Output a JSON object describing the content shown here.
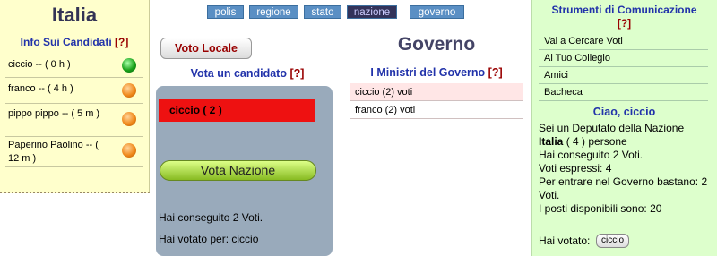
{
  "left": {
    "country": "Italia",
    "info_title": "Info Sui Candidati",
    "help": "[?]",
    "candidates": [
      {
        "name": "ciccio -- ( 0 h )",
        "status": "green"
      },
      {
        "name": "franco -- ( 4 h )",
        "status": "orange"
      },
      {
        "name": "pippo pippo -- ( 5 m )",
        "status": "orange"
      },
      {
        "name": "Paperino Paolino -- ( 12 m )",
        "status": "orange"
      }
    ]
  },
  "nav": {
    "items": [
      {
        "label": "polis"
      },
      {
        "label": "regione"
      },
      {
        "label": "stato"
      },
      {
        "label": "nazione",
        "active": true
      },
      {
        "label": "governo"
      }
    ]
  },
  "vote": {
    "locale_button": "Voto Locale",
    "title": "Vota un candidato",
    "help": "[?]",
    "selected": "ciccio ( 2 )",
    "vote_button": "Vota Nazione",
    "line1": "Hai conseguito 2 Voti.",
    "line2": "Hai votato per: ciccio"
  },
  "governo": {
    "title": "Governo",
    "subtitle": "I Ministri del Governo",
    "help": "[?]",
    "ministers": [
      {
        "label": "ciccio (2) voti"
      },
      {
        "label": "franco (2) voti"
      }
    ]
  },
  "right": {
    "title": "Strumenti di Comunicazione",
    "help": "[?]",
    "items": [
      {
        "label": "Vai a Cercare Voti"
      },
      {
        "label": "Al Tuo Collegio"
      },
      {
        "label": "Amici"
      },
      {
        "label": "Bacheca"
      }
    ],
    "greeting": "Ciao, ciccio",
    "p1": "Sei un Deputato della Nazione",
    "p2_bold": "Italia",
    "p2_rest": " ( 4 ) persone",
    "p3": "Hai conseguito 2 Voti.",
    "p4": "Voti espressi: 4",
    "p5": "Per entrare nel Governo bastano: 2 Voti.",
    "p6": "I posti disponibili sono: 20",
    "hai_votato": "Hai votato:",
    "chip": "ciccio"
  },
  "colors": {
    "nav_button": "#5a8fc4",
    "nav_active": "#33335a",
    "left_bg": "#ffffcc",
    "right_bg": "#ddffcc",
    "selected_candidate": "#ee1111"
  }
}
